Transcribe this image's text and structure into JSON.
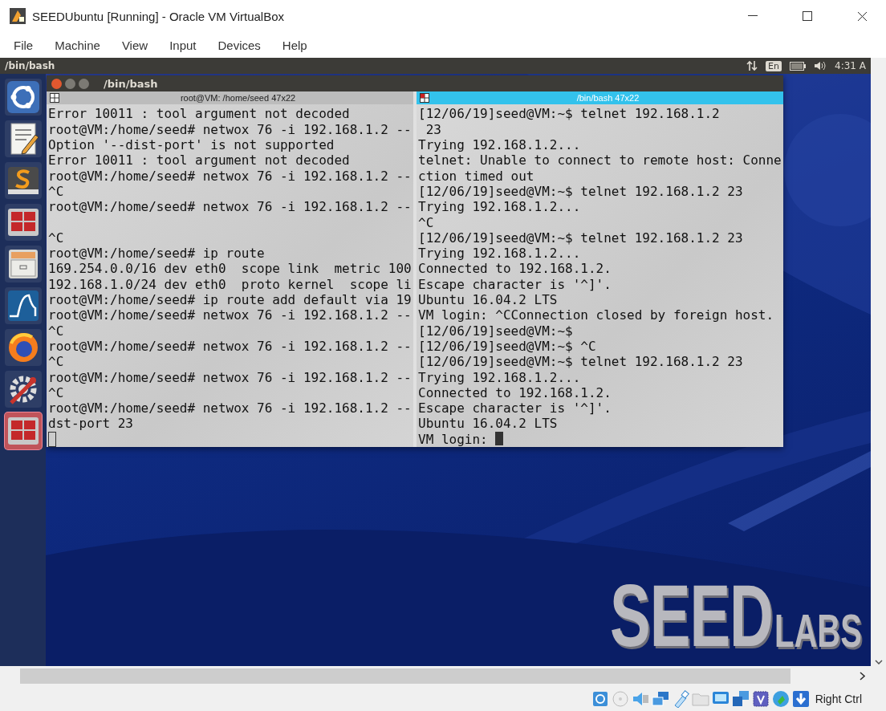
{
  "window": {
    "title": "SEEDUbuntu [Running] - Oracle VM VirtualBox"
  },
  "menu": [
    "File",
    "Machine",
    "View",
    "Input",
    "Devices",
    "Help"
  ],
  "top_panel": {
    "title": "/bin/bash",
    "keyboard": "En",
    "clock": "4:31 A"
  },
  "launcher": [
    {
      "kind": "home",
      "selected": false
    },
    {
      "kind": "editor",
      "selected": false
    },
    {
      "kind": "sublime",
      "selected": false
    },
    {
      "kind": "workspaces",
      "selected": false
    },
    {
      "kind": "files",
      "selected": false
    },
    {
      "kind": "wireshark",
      "selected": false
    },
    {
      "kind": "browser",
      "selected": false
    },
    {
      "kind": "settings",
      "selected": false
    },
    {
      "kind": "workspaces",
      "selected": true
    }
  ],
  "terminal": {
    "title": "/bin/bash",
    "panes": [
      {
        "title": "root@VM: /home/seed 47x22",
        "selected": false,
        "lines": [
          {
            "text": "Error 10011 : tool argument not decoded"
          },
          {
            "text": "root@VM:/home/seed# netwox 76 -i 192.168.1.2 --"
          },
          {
            "text": "Option '--dist-port' is not supported"
          },
          {
            "text": "Error 10011 : tool argument not decoded"
          },
          {
            "text": "root@VM:/home/seed# netwox 76 -i 192.168.1.2 --"
          },
          {
            "text": "^C"
          },
          {
            "text": "root@VM:/home/seed# netwox 76 -i 192.168.1.2 --"
          },
          {
            "text": "^C",
            "blank_line_before": true
          },
          {
            "text": "root@VM:/home/seed# ip route"
          },
          {
            "text": "169.254.0.0/16 dev eth0  scope link  metric 100"
          },
          {
            "text": "192.168.1.0/24 dev eth0  proto kernel  scope li"
          },
          {
            "text": "root@VM:/home/seed# ip route add default via 19"
          },
          {
            "text": "root@VM:/home/seed# netwox 76 -i 192.168.1.2 --"
          },
          {
            "text": "^C"
          },
          {
            "text": "root@VM:/home/seed# netwox 76 -i 192.168.1.2 --"
          },
          {
            "text": "^C"
          },
          {
            "text": "root@VM:/home/seed# netwox 76 -i 192.168.1.2 --"
          },
          {
            "text": "^C"
          },
          {
            "text": "root@VM:/home/seed# netwox 76 -i 192.168.1.2 --"
          },
          {
            "text": "dst-port 23"
          },
          {
            "cursor": true
          }
        ]
      },
      {
        "title": "/bin/bash 47x22",
        "selected": true,
        "lines": [
          {
            "text": "[12/06/19]seed@VM:~$ telnet 192.168.1.2"
          },
          {
            "text": " 23"
          },
          {
            "text": "Trying 192.168.1.2..."
          },
          {
            "text": "telnet: Unable to connect to remote host: Conne"
          },
          {
            "text": "ction timed out"
          },
          {
            "text": "[12/06/19]seed@VM:~$ telnet 192.168.1.2 23"
          },
          {
            "text": "Trying 192.168.1.2..."
          },
          {
            "text": "^C"
          },
          {
            "text": "[12/06/19]seed@VM:~$ telnet 192.168.1.2 23"
          },
          {
            "text": "Trying 192.168.1.2..."
          },
          {
            "text": "Connected to 192.168.1.2."
          },
          {
            "text": "Escape character is '^]'."
          },
          {
            "text": "Ubuntu 16.04.2 LTS"
          },
          {
            "text": "VM login: ^CConnection closed by foreign host."
          },
          {
            "text": "[12/06/19]seed@VM:~$"
          },
          {
            "text": "[12/06/19]seed@VM:~$ ^C"
          },
          {
            "text": "[12/06/19]seed@VM:~$ telnet 192.168.1.2 23"
          },
          {
            "text": "Trying 192.168.1.2..."
          },
          {
            "text": "Connected to 192.168.1.2."
          },
          {
            "text": "Escape character is '^]'."
          },
          {
            "text": "Ubuntu 16.04.2 LTS"
          },
          {
            "text": "VM login:",
            "cursor": true
          }
        ]
      }
    ]
  },
  "wallpaper_logo": {
    "main": "SEED",
    "suffix": "LABS"
  },
  "status_bar": {
    "indicators": [
      {
        "kind": "disk"
      },
      {
        "kind": "optical"
      },
      {
        "kind": "audio"
      },
      {
        "kind": "network"
      },
      {
        "kind": "usb"
      },
      {
        "kind": "shared-folder"
      },
      {
        "kind": "display"
      },
      {
        "kind": "capture"
      },
      {
        "kind": "cpu"
      },
      {
        "kind": "globe"
      },
      {
        "kind": "keyboard"
      }
    ],
    "host_key": "Right Ctrl"
  }
}
